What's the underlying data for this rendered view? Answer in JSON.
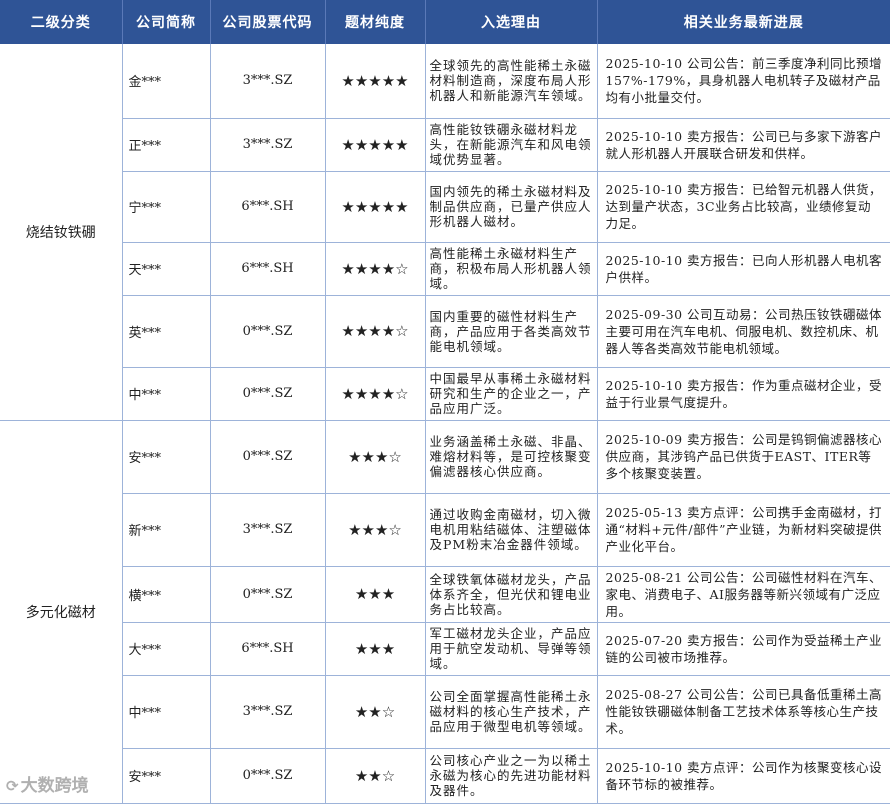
{
  "headers": [
    "二级分类",
    "公司简称",
    "公司股票代码",
    "题材纯度",
    "入选理由",
    "相关业务最新进展"
  ],
  "groups": [
    {
      "category": "烧结钕铁硼",
      "rows": [
        {
          "name": "金***",
          "code": "3***.SZ",
          "stars": "★★★★★",
          "reason": "全球领先的高性能稀土永磁材料制造商，深度布局人形机器人和新能源汽车领域。",
          "progress": "2025-10-10 公司公告：前三季度净利同比预增157%-179%，具身机器人电机转子及磁材产品均有小批量交付。"
        },
        {
          "name": "正***",
          "code": "3***.SZ",
          "stars": "★★★★★",
          "reason": "高性能钕铁硼永磁材料龙头，在新能源汽车和风电领域优势显著。",
          "progress": "2025-10-10 卖方报告：公司已与多家下游客户就人形机器人开展联合研发和供样。"
        },
        {
          "name": "宁***",
          "code": "6***.SH",
          "stars": "★★★★★",
          "reason": "国内领先的稀土永磁材料及制品供应商，已量产供应人形机器人磁材。",
          "progress": "2025-10-10 卖方报告：已给智元机器人供货，达到量产状态，3C业务占比较高，业绩修复动力足。"
        },
        {
          "name": "天***",
          "code": "6***.SH",
          "stars": "★★★★☆",
          "reason": "高性能稀土永磁材料生产商，积极布局人形机器人领域。",
          "progress": "2025-10-10 卖方报告：已向人形机器人电机客户供样。"
        },
        {
          "name": "英***",
          "code": "0***.SZ",
          "stars": "★★★★☆",
          "reason": "国内重要的磁性材料生产商，产品应用于各类高效节能电机领域。",
          "progress": "2025-09-30 公司互动易：公司热压钕铁硼磁体主要可用在汽车电机、伺服电机、数控机床、机器人等各类高效节能电机领域。"
        },
        {
          "name": "中***",
          "code": "0***.SZ",
          "stars": "★★★★☆",
          "reason": "中国最早从事稀土永磁材料研究和生产的企业之一，产品应用广泛。",
          "progress": "2025-10-10 卖方报告：作为重点磁材企业，受益于行业景气度提升。"
        }
      ]
    },
    {
      "category": "多元化磁材",
      "rows": [
        {
          "name": "安***",
          "code": "0***.SZ",
          "stars": "★★★☆",
          "reason": "业务涵盖稀土永磁、非晶、难熔材料等，是可控核聚变偏滤器核心供应商。",
          "progress": "2025-10-09 卖方报告：公司是钨铜偏滤器核心供应商，其涉钨产品已供货于EAST、ITER等多个核聚变装置。"
        },
        {
          "name": "新***",
          "code": "3***.SZ",
          "stars": "★★★☆",
          "reason": "通过收购金南磁材，切入微电机用粘结磁体、注塑磁体及PM粉末冶金器件领域。",
          "progress": "2025-05-13 卖方点评：公司携手金南磁材，打通“材料+元件/部件”产业链，为新材料突破提供产业化平台。"
        },
        {
          "name": "横***",
          "code": "0***.SZ",
          "stars": "★★★",
          "reason": "全球铁氧体磁材龙头，产品体系齐全，但光伏和锂电业务占比较高。",
          "progress": "2025-08-21 公司公告：公司磁性材料在汽车、家电、消费电子、AI服务器等新兴领域有广泛应用。"
        },
        {
          "name": "大***",
          "code": "6***.SH",
          "stars": "★★★",
          "reason": "军工磁材龙头企业，产品应用于航空发动机、导弹等领域。",
          "progress": "2025-07-20 卖方报告：公司作为受益稀土产业链的公司被市场推荐。"
        },
        {
          "name": "中***",
          "code": "3***.SZ",
          "stars": "★★☆",
          "reason": "公司全面掌握高性能稀土永磁材料的核心生产技术，产品应用于微型电机等领域。",
          "progress": "2025-08-27 公司公告：公司已具备低重稀土高性能钕铁硼磁体制备工艺技术体系等核心生产技术。"
        },
        {
          "name": "安***",
          "code": "0***.SZ",
          "stars": "★★☆",
          "reason": "公司核心产业之一为以稀土永磁为核心的先进功能材料及器件。",
          "progress": "2025-10-10 卖方点评：公司作为核聚变核心设备环节标的被推荐。"
        }
      ]
    }
  ],
  "watermark": "大数跨境"
}
